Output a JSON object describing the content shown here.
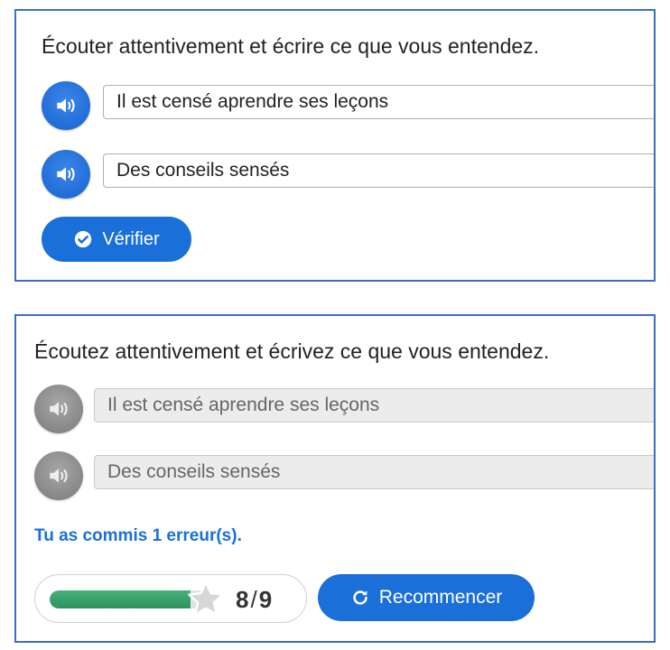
{
  "exercise_before": {
    "instruction": "Écouter attentivement et écrire ce que vous entendez.",
    "items": [
      {
        "icon": "speaker-icon",
        "answer": "Il est censé aprendre ses leçons"
      },
      {
        "icon": "speaker-icon",
        "answer": "Des conseils sensés"
      }
    ],
    "check_button": {
      "icon": "check-circle-icon",
      "label": "Vérifier"
    },
    "colors": {
      "accent": "#1b6fd8",
      "border": "#3e6dc4"
    }
  },
  "exercise_after": {
    "instruction": "Écoutez attentivement et écrivez ce que vous entendez.",
    "items": [
      {
        "icon": "speaker-icon",
        "answer": "Il est censé aprendre ses leçons"
      },
      {
        "icon": "speaker-icon",
        "answer": "Des conseils sensés"
      }
    ],
    "feedback": "Tu as commis 1 erreur(s).",
    "score": {
      "obtained": "8",
      "separator": "/",
      "total": "9",
      "progress_fraction": 0.889,
      "icon": "star-icon"
    },
    "restart_button": {
      "icon": "refresh-icon",
      "label": "Recommencer"
    },
    "colors": {
      "feedback": "#1a70d6",
      "progress": "#2f925d",
      "disabled": "#ececec"
    }
  }
}
